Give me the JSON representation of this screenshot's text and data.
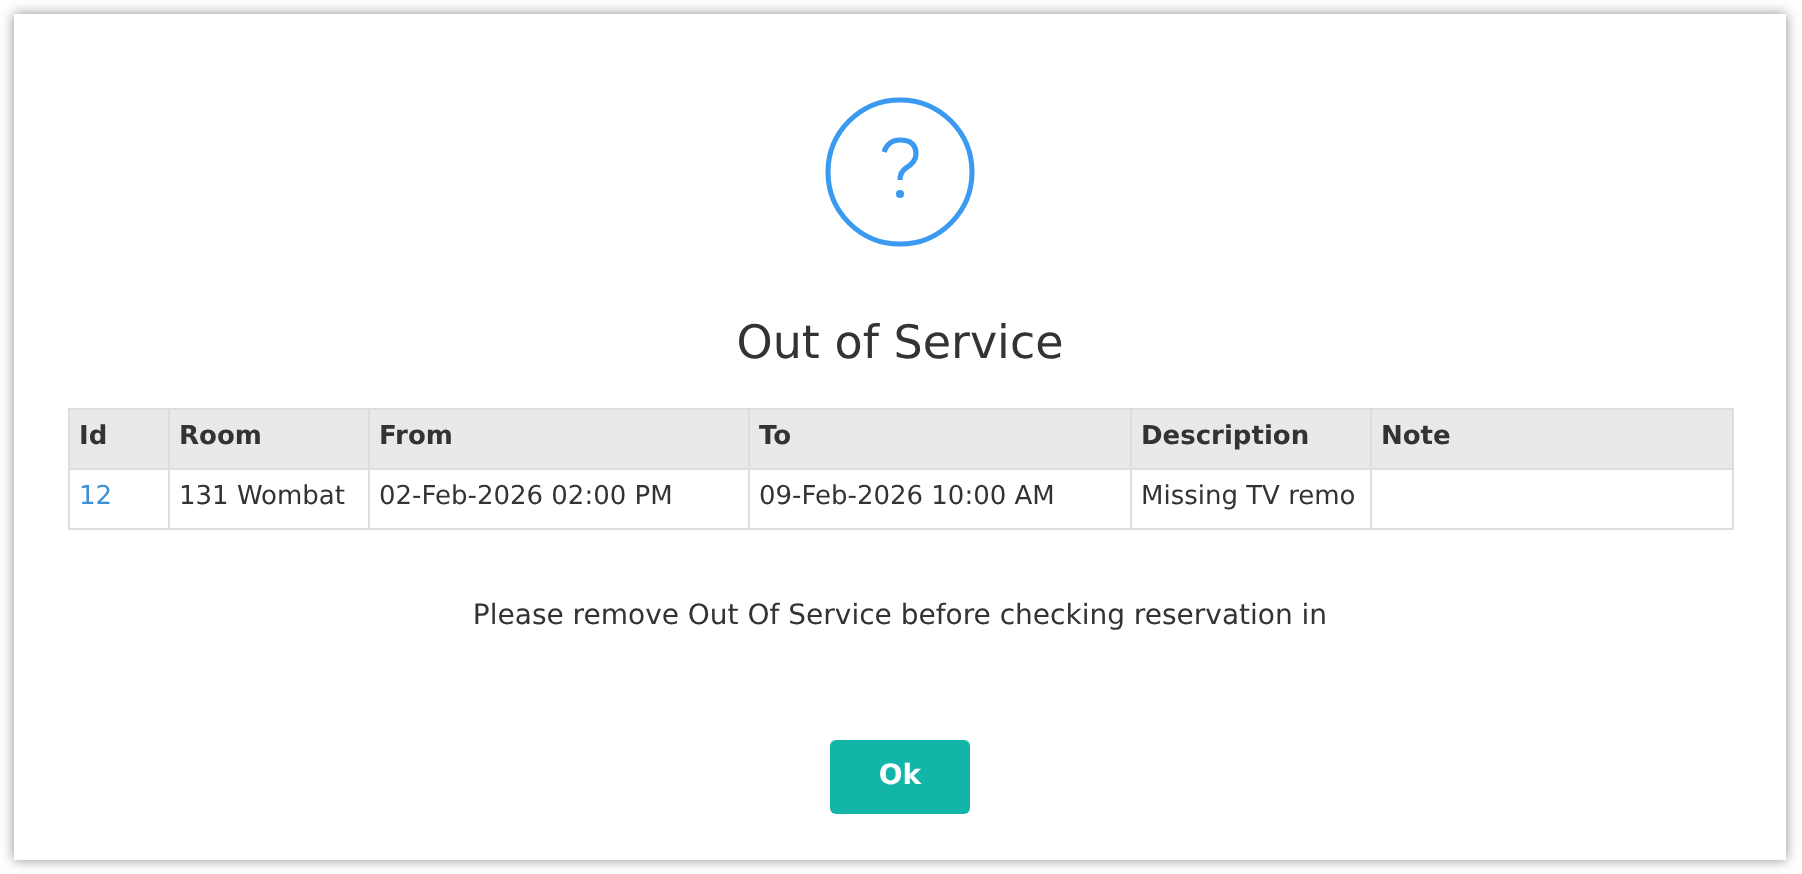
{
  "dialog": {
    "title": "Out of Service",
    "table": {
      "columns": [
        "Id",
        "Room",
        "From",
        "To",
        "Description",
        "Note"
      ],
      "rows": [
        {
          "id": "12",
          "room": "131 Wombat",
          "from": "02-Feb-2026 02:00 PM",
          "to": "09-Feb-2026 10:00 AM",
          "description": "Missing TV remo"
        }
      ]
    },
    "message": "Please remove Out Of Service before checking reservation in",
    "buttons": [
      "Ok"
    ]
  }
}
